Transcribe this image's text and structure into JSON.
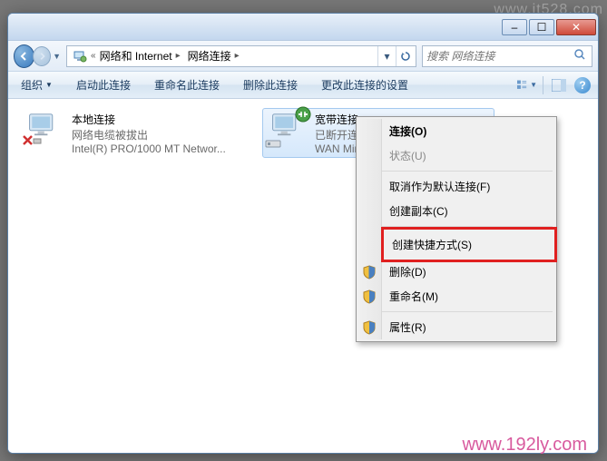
{
  "watermarks": {
    "top": "www.jt528.com",
    "bottom": "www.192ly.com"
  },
  "titlebar": {
    "min": "–",
    "max": "☐",
    "close": "✕"
  },
  "address": {
    "seg1": "网络和 Internet",
    "seg2": "网络连接"
  },
  "search": {
    "placeholder": "搜索 网络连接"
  },
  "toolbar": {
    "organize": "组织",
    "start": "启动此连接",
    "rename": "重命名此连接",
    "delete": "删除此连接",
    "change": "更改此连接的设置"
  },
  "connections": {
    "local": {
      "title": "本地连接",
      "line1": "网络电缆被拔出",
      "line2": "Intel(R) PRO/1000 MT Networ..."
    },
    "broadband": {
      "title": "宽带连接",
      "line1": "已断开连接",
      "line2": "WAN Min..."
    }
  },
  "ctx": {
    "connect": "连接(O)",
    "status": "状态(U)",
    "unsetdefault": "取消作为默认连接(F)",
    "copy": "创建副本(C)",
    "shortcut": "创建快捷方式(S)",
    "delete": "删除(D)",
    "rename": "重命名(M)",
    "props": "属性(R)"
  }
}
